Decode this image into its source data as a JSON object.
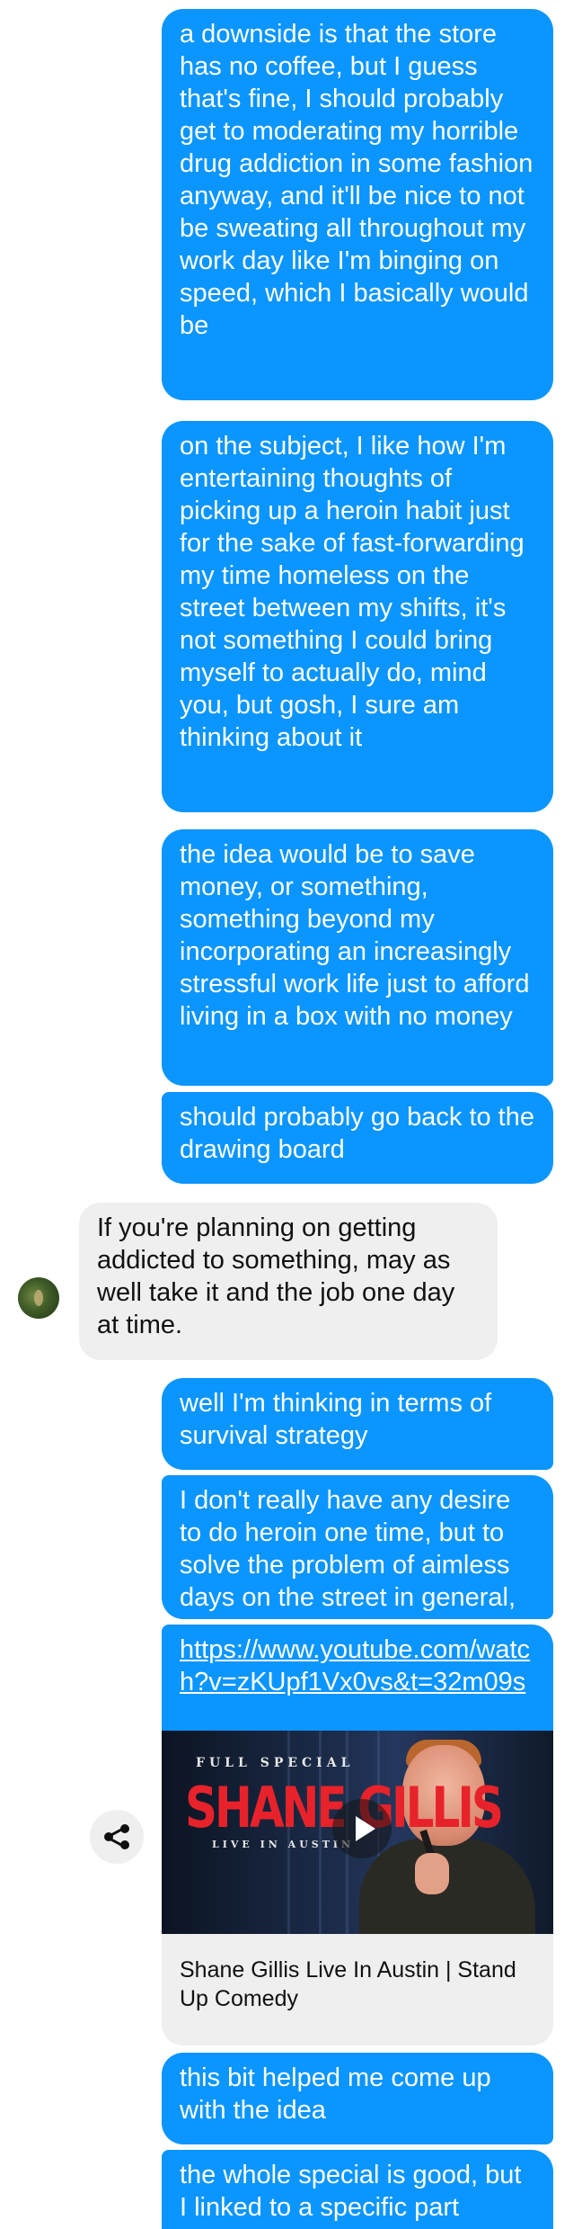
{
  "messages": [
    {
      "side": "out",
      "text": "a downside is that the store has no coffee, but I guess that's fine, I should probably get to moderating my horrible drug addiction in some fashion anyway, and it'll be nice to not be sweating all throughout my work day like I'm binging on speed, which I basically would be"
    },
    {
      "side": "out",
      "text": "on the subject, I like how I'm entertaining thoughts of picking up a heroin habit just for the sake of fast-forwarding my time homeless on the street between my shifts, it's not something I could bring myself to actually do, mind you, but gosh, I sure am thinking about it"
    },
    {
      "side": "out",
      "text": "the idea would be to save money, or something, something beyond my incorporating an increasingly stressful work life just to afford living in a box with no money"
    },
    {
      "side": "out",
      "text": "should probably go back to the drawing board"
    },
    {
      "side": "in",
      "text": "If you're planning on getting addicted to something, may as well take it and the job one day at time."
    },
    {
      "side": "out",
      "text": "well I'm thinking in terms of survival strategy"
    },
    {
      "side": "out",
      "text": "I don't really have any desire to do heroin one time, but to solve the problem of aimless days on the street in general, that would be nice"
    },
    {
      "side": "out",
      "text": "this bit helped me come up with the idea"
    },
    {
      "side": "out",
      "text": "the whole special is good, but I linked to a specific part"
    }
  ],
  "link_preview": {
    "url": "https://www.youtube.com/watch?v=zKUpf1Vx0vs&t=32m09s",
    "thumb_kicker": "FULL SPECIAL",
    "thumb_title": "SHANE GILLIS",
    "thumb_sub": "LIVE IN AUSTIN",
    "title": "Shane Gillis Live In Austin | Stand Up Comedy"
  },
  "icons": {
    "play": "play-icon",
    "share": "share-icon",
    "avatar": "contact-avatar"
  },
  "colors": {
    "outgoing_bubble": "#0a95ff",
    "incoming_bubble": "#efefef"
  }
}
